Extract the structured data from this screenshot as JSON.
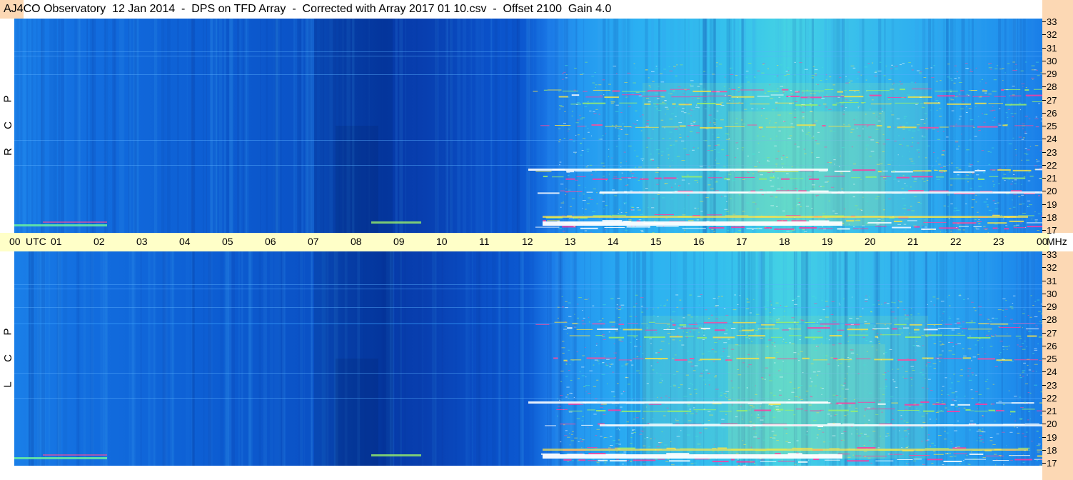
{
  "header": {
    "title": "AJ4CO Observatory  12 Jan 2014  -  DPS on TFD Array  -  Corrected with Array 2017 01 10.csv  -  Offset 2100  Gain 4.0"
  },
  "panels": [
    {
      "id": "rcp",
      "polarization_letters": [
        "P",
        "C",
        "R"
      ]
    },
    {
      "id": "lcp",
      "polarization_letters": [
        "P",
        "C",
        "L"
      ]
    }
  ],
  "time_axis": {
    "labels": [
      "00",
      "UTC",
      "01",
      "02",
      "03",
      "04",
      "05",
      "06",
      "07",
      "08",
      "09",
      "10",
      "11",
      "12",
      "13",
      "14",
      "15",
      "16",
      "17",
      "18",
      "19",
      "20",
      "21",
      "22",
      "23",
      "00",
      "MHz"
    ]
  },
  "frequency_axis": {
    "labels": [
      "33",
      "32",
      "31",
      "30",
      "29",
      "28",
      "27",
      "26",
      "25",
      "24",
      "23",
      "22",
      "21",
      "20",
      "19",
      "18",
      "17"
    ],
    "range_mhz": [
      17,
      33
    ]
  },
  "colors": {
    "background_blue": "#0a5fd6",
    "time_axis_bg": "#ffffc8",
    "right_strip_bg": "#fcd8b4"
  }
}
